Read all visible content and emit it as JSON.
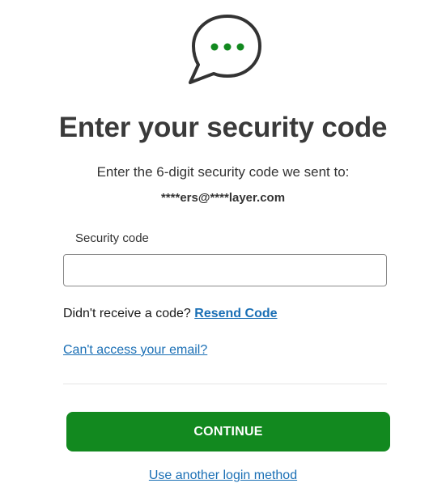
{
  "header": {
    "icon": "chat-bubble-ellipsis-icon",
    "title": "Enter your security code",
    "subtitle": "Enter the 6-digit security code we sent to:",
    "masked_email": "****ers@****layer.com"
  },
  "form": {
    "security_code_label": "Security code",
    "security_code_value": "",
    "resend_prompt": "Didn't receive a code?",
    "resend_link": "Resend Code",
    "cant_access_link": "Can't access your email?",
    "continue_label": "CONTINUE",
    "other_method_link": "Use another login method"
  },
  "colors": {
    "primary_green": "#12891f",
    "link_blue": "#1a6fb5",
    "icon_dots": "#12891f",
    "icon_outline": "#333333"
  }
}
